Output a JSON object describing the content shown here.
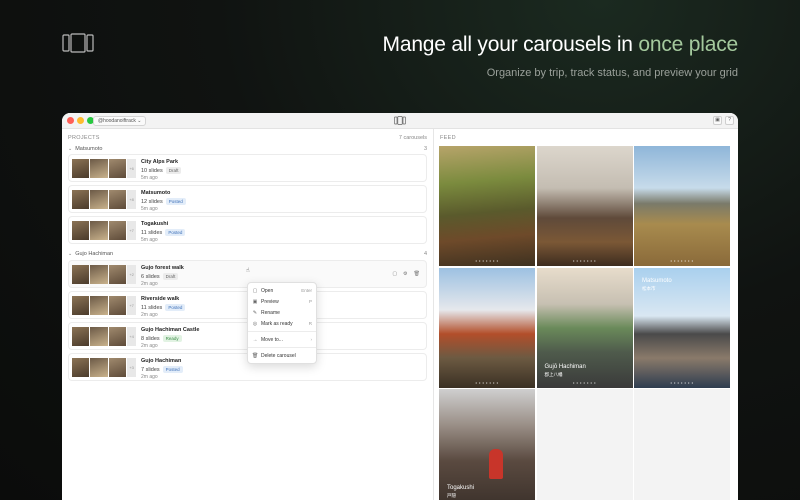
{
  "hero": {
    "title_main": "Mange all your carousels in ",
    "title_accent": "once place",
    "subtitle": "Organize by trip, track status, and preview your grid"
  },
  "titlebar": {
    "account": "@hoodanoiftrack ⌄",
    "right_buttons": [
      "▣",
      "?"
    ]
  },
  "projects": {
    "label": "PROJECTS",
    "count": "7 carousels",
    "groups": [
      {
        "name": "Matsumoto",
        "count": "3",
        "items": [
          {
            "title": "City Alps Park",
            "slides": "10 slides",
            "status": "Draft",
            "time": "5m ago",
            "extra": "+6"
          },
          {
            "title": "Matsumoto",
            "slides": "12 slides",
            "status": "Posted",
            "time": "5m ago",
            "extra": "+8"
          },
          {
            "title": "Togakushi",
            "slides": "11 slides",
            "status": "Posted",
            "time": "5m ago",
            "extra": "+7"
          }
        ]
      },
      {
        "name": "Gujo Hachiman",
        "count": "4",
        "items": [
          {
            "title": "Gujo forest walk",
            "slides": "6 slides",
            "status": "Draft",
            "time": "2m ago",
            "extra": "+2"
          },
          {
            "title": "Riverside walk",
            "slides": "11 slides",
            "status": "Posted",
            "time": "2m ago",
            "extra": "+7"
          },
          {
            "title": "Gujo Hachiman Castle",
            "slides": "8 slides",
            "status": "Ready",
            "time": "2m ago",
            "extra": "+4"
          },
          {
            "title": "Gujo Hachiman",
            "slides": "7 slides",
            "status": "Posted",
            "time": "2m ago",
            "extra": "+3"
          }
        ]
      }
    ]
  },
  "context_menu": {
    "open": "Open",
    "open_shortcut": "Enter",
    "preview": "Preview",
    "preview_shortcut": "P",
    "rename": "Rename",
    "mark_as_ready": "Mark as ready",
    "mark_shortcut": "R",
    "move_to": "Move to...",
    "delete": "Delete carousel"
  },
  "feed": {
    "label": "FEED",
    "captions": {
      "matsumoto": "Matsumoto",
      "matsumoto_jp": "松本市",
      "gujo": "Gujō Hachiman",
      "gujo_jp": "郡上八幡",
      "togakushi": "Togakushi",
      "togakushi_jp": "戸隠"
    },
    "dots": "• • • • • • •"
  }
}
